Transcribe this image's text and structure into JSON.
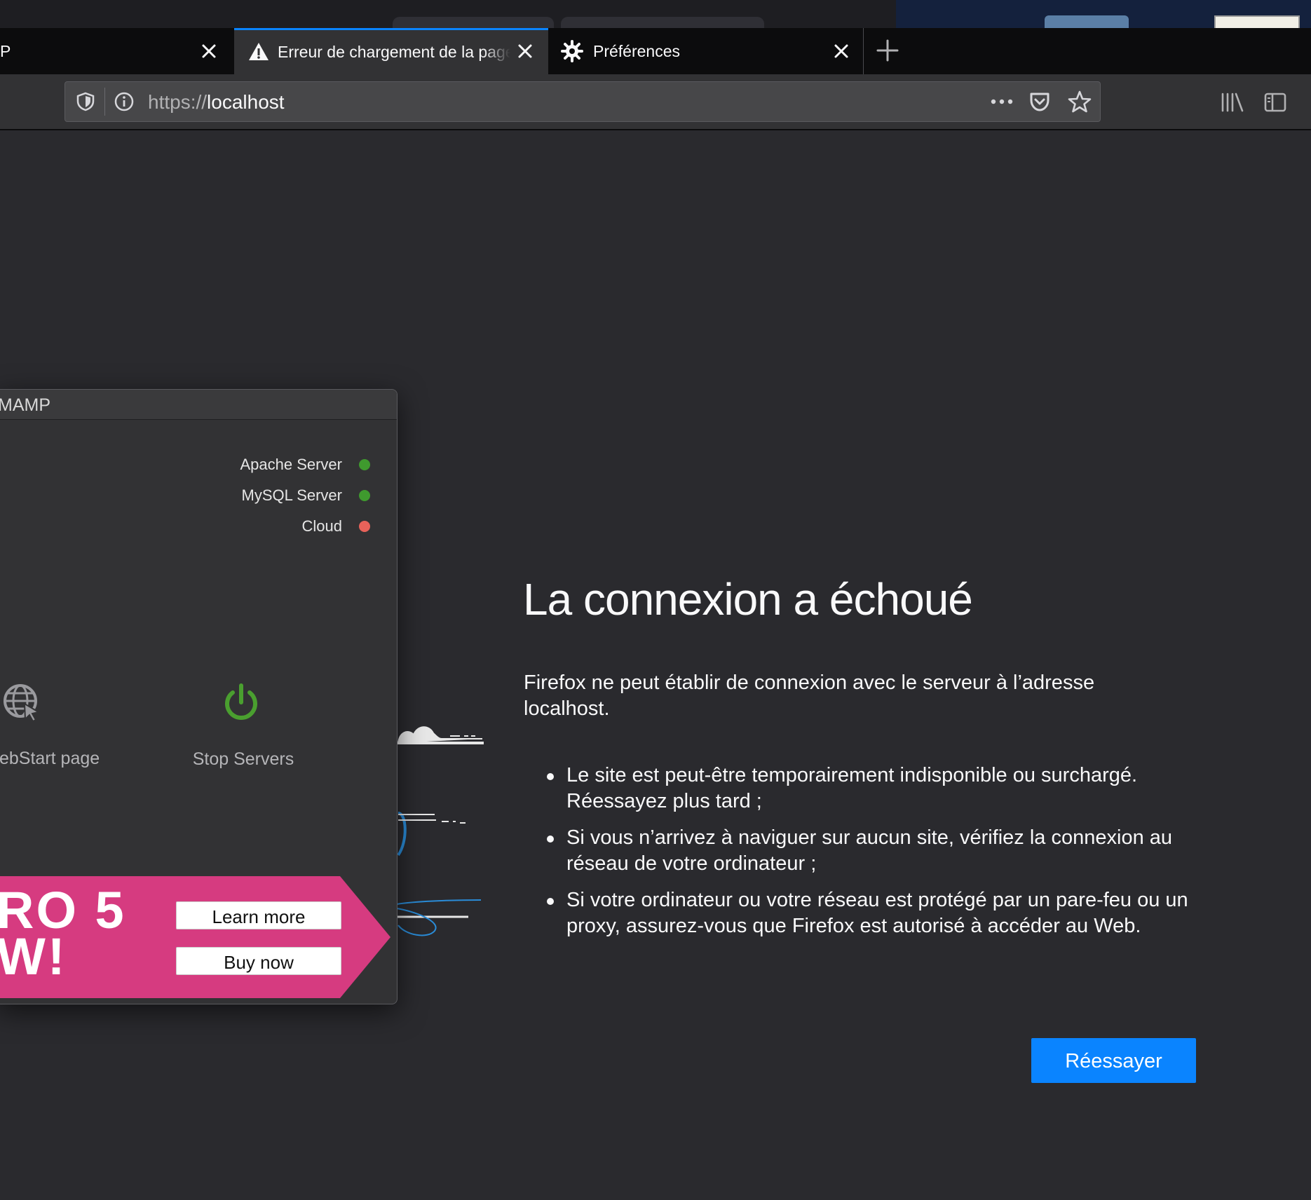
{
  "tabs": [
    {
      "label": "P"
    },
    {
      "label": "Erreur de chargement de la page"
    },
    {
      "label": "Préférences"
    }
  ],
  "urlbar": {
    "protocol": "https://",
    "host": "localhost"
  },
  "error": {
    "title": "La connexion a échoué",
    "description": "Firefox ne peut établir de connexion avec le serveur à l’adresse localhost.",
    "bullets": [
      "Le site est peut-être temporairement indisponible ou surchargé. Réessayez plus tard ;",
      "Si vous n’arrivez à naviguer sur aucun site, vérifiez la connexion au réseau de votre ordinateur ;",
      "Si votre ordinateur ou votre réseau est protégé par un pare-feu ou un proxy, assurez-vous que Firefox est autorisé à accéder au Web."
    ],
    "retry_label": "Réessayer"
  },
  "mamp": {
    "title": "MAMP",
    "servers": [
      {
        "name": "Apache Server",
        "status_color": "#3f9a2e"
      },
      {
        "name": "MySQL Server",
        "status_color": "#3f9a2e"
      },
      {
        "name": "Cloud",
        "status_color": "#e8625a"
      }
    ],
    "webstart_label": "ebStart page",
    "stop_label": "Stop Servers",
    "promo": {
      "line1": "RO 5",
      "line2": "W!",
      "learn_more": "Learn more",
      "buy_now": "Buy now",
      "color": "#d63b80"
    }
  },
  "colors": {
    "accent": "#0a84ff",
    "background": "#2a2a2e"
  }
}
